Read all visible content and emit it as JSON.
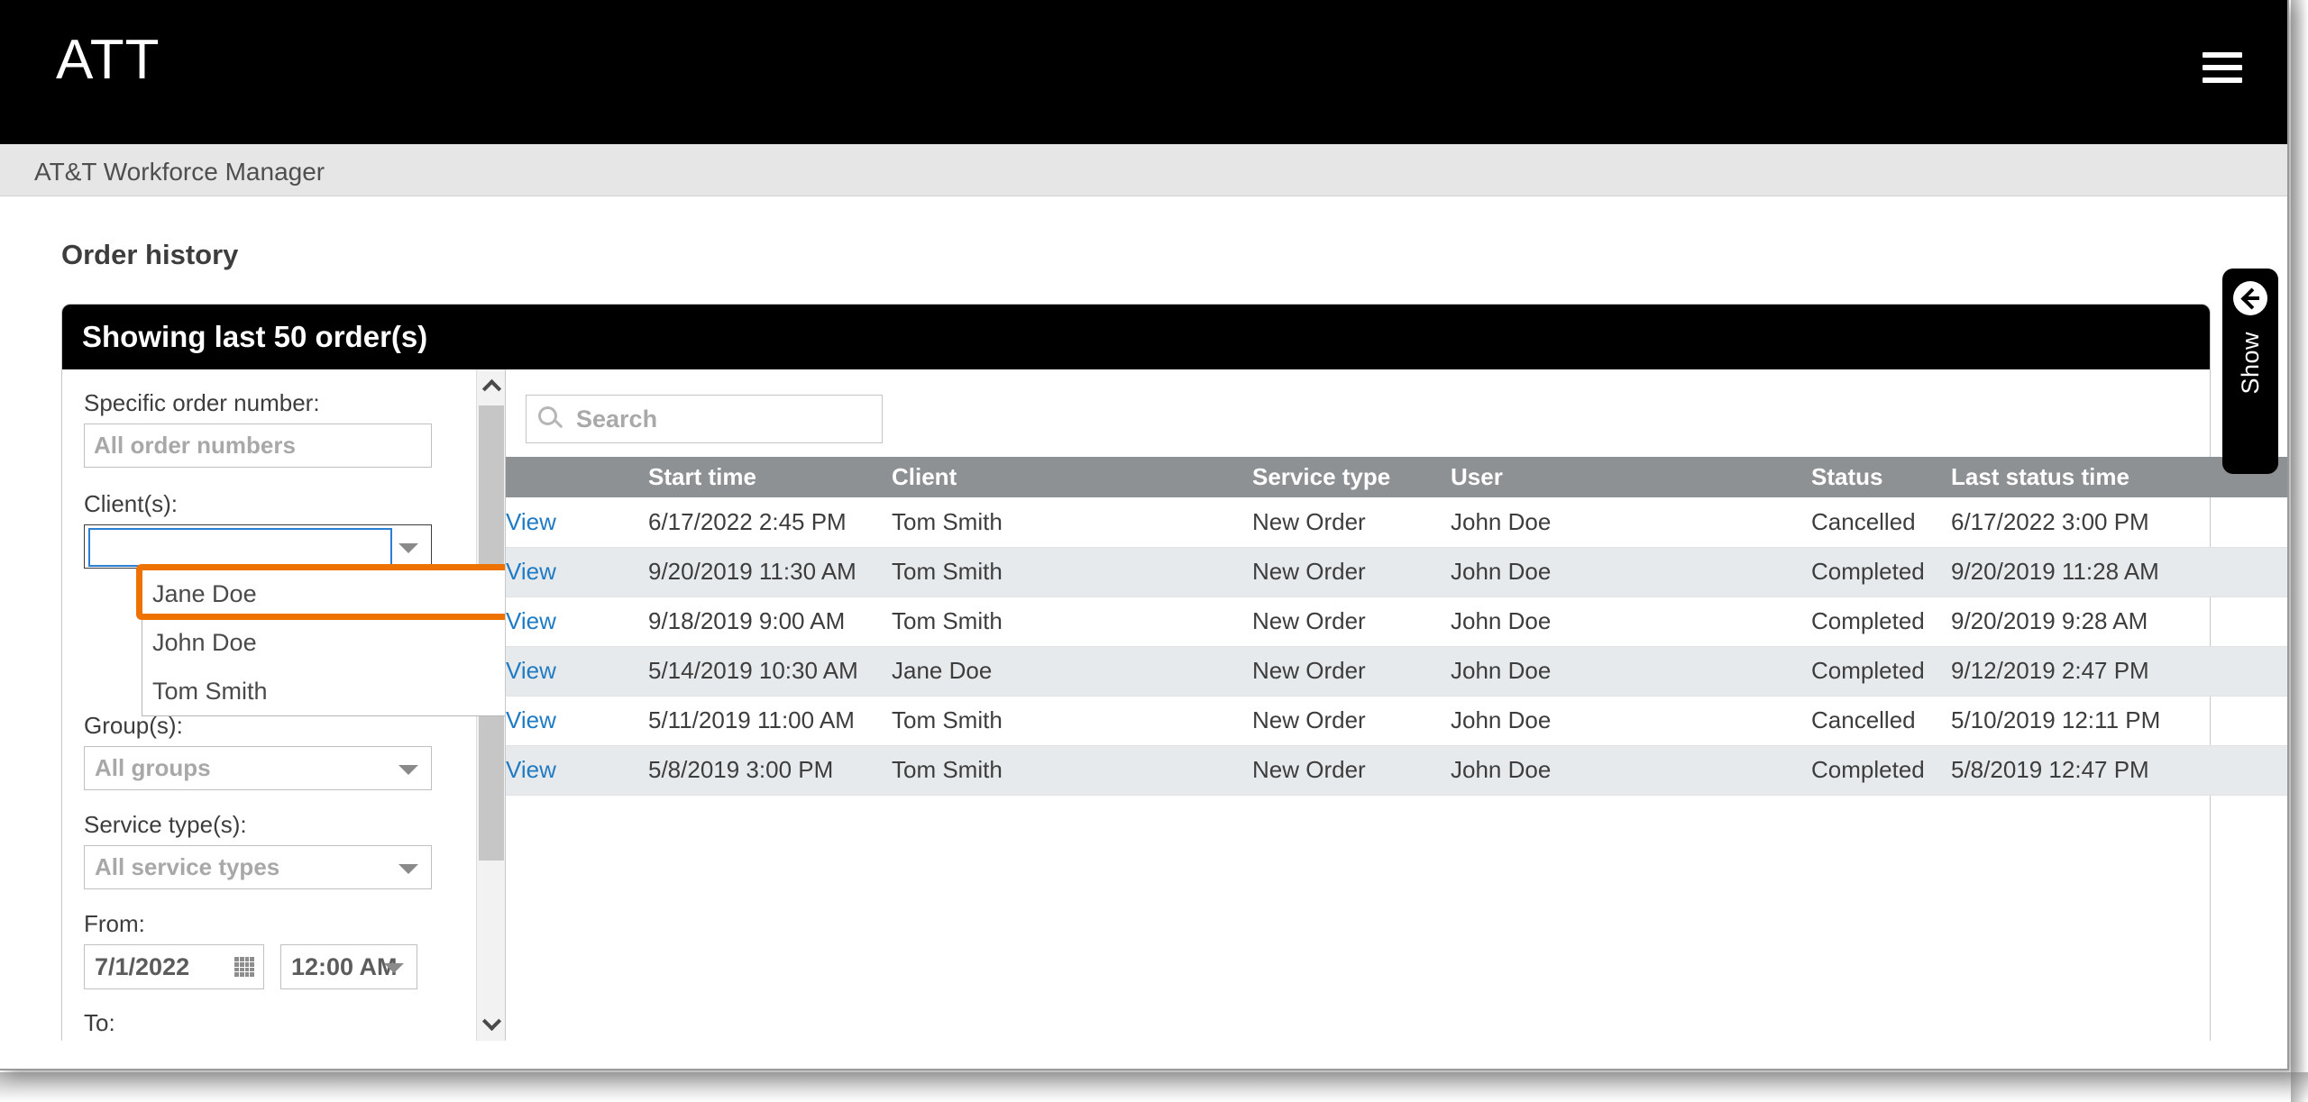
{
  "topbar": {
    "brand": "ATT",
    "menu_icon": "hamburger-icon"
  },
  "subheader": {
    "text": "AT&T Workforce Manager"
  },
  "page": {
    "title": "Order history"
  },
  "card": {
    "header_title": "Showing last 50 order(s)"
  },
  "filters": {
    "order_number_label": "Specific order number:",
    "order_number_placeholder": "All order numbers",
    "order_number_value": "",
    "client_label": "Client(s):",
    "client_value": "",
    "client_options": [
      "Jane Doe",
      "John Doe",
      "Tom Smith"
    ],
    "client_highlighted_option": "Jane Doe",
    "group_label": "Group(s):",
    "group_value": "All groups",
    "service_label": "Service type(s):",
    "service_value": "All service types",
    "from_label": "From:",
    "from_date": "7/1/2022",
    "from_time": "12:00 AM",
    "to_label": "To:"
  },
  "search": {
    "placeholder": "Search",
    "value": ""
  },
  "table": {
    "columns": [
      "",
      "Start time",
      "Client",
      "Service type",
      "User",
      "Status",
      "Last status time"
    ],
    "rows": [
      {
        "action": "View",
        "start_time": "6/17/2022 2:45 PM",
        "client": "Tom Smith",
        "service_type": "New Order",
        "user": "John Doe",
        "status": "Cancelled",
        "last_status_time": "6/17/2022 3:00 PM"
      },
      {
        "action": "View",
        "start_time": "9/20/2019 11:30 AM",
        "client": "Tom Smith",
        "service_type": "New Order",
        "user": "John Doe",
        "status": "Completed",
        "last_status_time": "9/20/2019 11:28 AM"
      },
      {
        "action": "View",
        "start_time": "9/18/2019 9:00 AM",
        "client": "Tom Smith",
        "service_type": "New Order",
        "user": "John Doe",
        "status": "Completed",
        "last_status_time": "9/20/2019 9:28 AM"
      },
      {
        "action": "View",
        "start_time": "5/14/2019 10:30 AM",
        "client": "Jane Doe",
        "service_type": "New Order",
        "user": "John Doe",
        "status": "Completed",
        "last_status_time": "9/12/2019 2:47 PM"
      },
      {
        "action": "View",
        "start_time": "5/11/2019 11:00 AM",
        "client": "Tom Smith",
        "service_type": "New Order",
        "user": "John Doe",
        "status": "Cancelled",
        "last_status_time": "5/10/2019 12:11 PM"
      },
      {
        "action": "View",
        "start_time": "5/8/2019 3:00 PM",
        "client": "Tom Smith",
        "service_type": "New Order",
        "user": "John Doe",
        "status": "Completed",
        "last_status_time": "5/8/2019 12:47 PM"
      }
    ]
  },
  "side_tab": {
    "label": "Show",
    "icon": "arrow-left-circle-icon"
  },
  "colors": {
    "brand_bar": "#000000",
    "highlight_ring": "#ee7202",
    "focus_border": "#2a7fd4",
    "table_header": "#8e9194",
    "link": "#1f7bc4",
    "alt_row": "#e7eaec"
  }
}
